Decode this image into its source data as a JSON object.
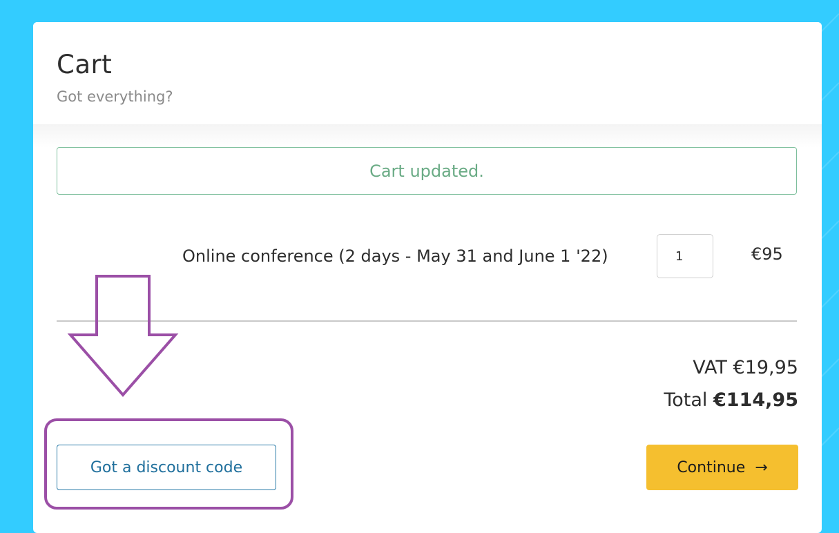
{
  "colors": {
    "background": "#33ccff",
    "card": "#ffffff",
    "alert_border": "#7dbf9c",
    "alert_text": "#6aab85",
    "discount_accent": "#1f6f9c",
    "continue_bg": "#f5bf2f",
    "annotation": "#9b4fa6"
  },
  "header": {
    "title": "Cart",
    "subtitle": "Got everything?"
  },
  "alert": {
    "message": "Cart updated."
  },
  "cart": {
    "items": [
      {
        "name": "Online conference (2 days - May 31 and June 1 '22)",
        "quantity": "1",
        "price": "€95"
      }
    ]
  },
  "summary": {
    "vat_label": "VAT",
    "vat_amount": "€19,95",
    "total_label": "Total",
    "total_amount": "€114,95"
  },
  "actions": {
    "discount_label": "Got a discount code",
    "continue_label": "Continue",
    "continue_icon": "arrow-right-icon",
    "continue_glyph": "→"
  },
  "annotations": {
    "arrow": "down-arrow-outline",
    "highlight": "rounded-rectangle-outline"
  }
}
